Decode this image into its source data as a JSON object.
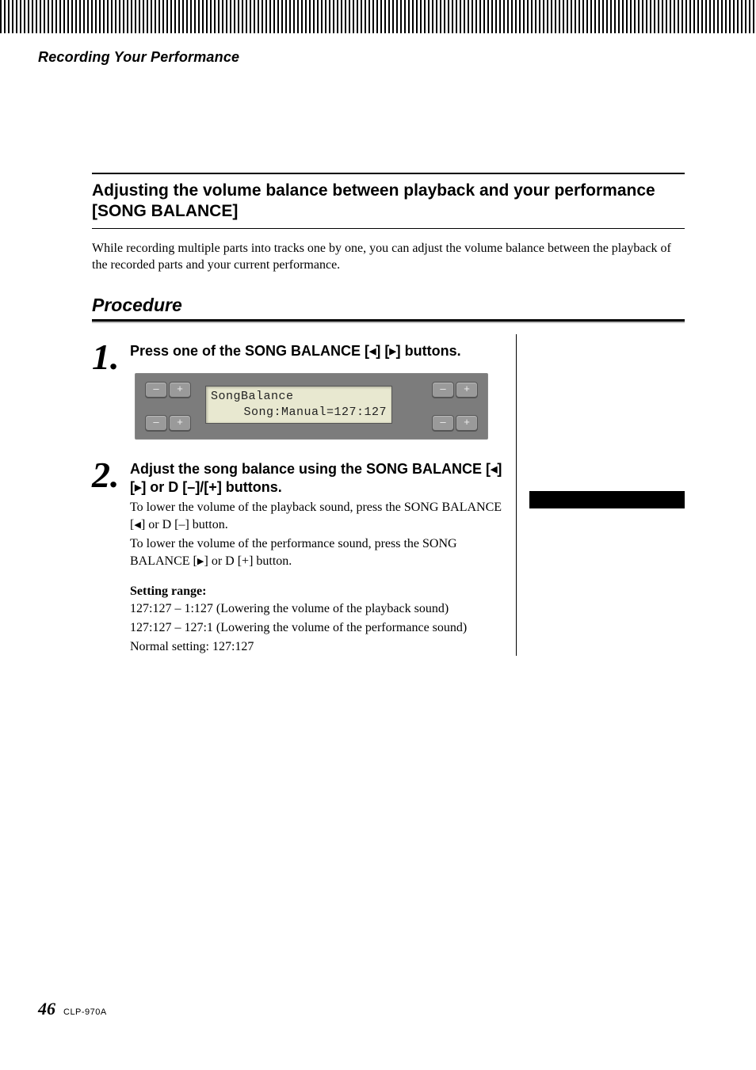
{
  "header": {
    "section": "Recording Your Performance"
  },
  "topic": {
    "title": "Adjusting the volume balance between playback and your performance [SONG BALANCE]",
    "intro": "While recording multiple parts into tracks one by one, you can adjust the volume balance between the playback of the recorded parts and your current performance."
  },
  "procedure": {
    "heading": "Procedure"
  },
  "glyph": {
    "left": "◀",
    "right": "▶"
  },
  "steps": [
    {
      "num": "1.",
      "head_pre": "Press one of the SONG BALANCE [",
      "head_mid": "] [",
      "head_post": "] buttons."
    },
    {
      "num": "2.",
      "head_pre": "Adjust the song balance using the SONG BALANCE [",
      "head_mid": "] [",
      "head_post": "] or D [–]/[+] buttons.",
      "p1_pre": "To lower the volume of the playback sound, press the SONG BALANCE [",
      "p1_post": "] or D [–] button.",
      "p2_pre": "To lower the volume of the performance sound, press the SONG BALANCE [",
      "p2_post": "] or D [+] button."
    }
  ],
  "lcd": {
    "line1": "SongBalance",
    "line2": "Song:Manual=127:127"
  },
  "panel": {
    "minus": "–",
    "plus": "+"
  },
  "range": {
    "head": "Setting range:",
    "l1": "127:127 – 1:127 (Lowering the volume of the playback sound)",
    "l2": "127:127 – 127:1 (Lowering the volume of the performance sound)",
    "l3": "Normal setting: 127:127"
  },
  "footer": {
    "page": "46",
    "model": "CLP-970A"
  }
}
